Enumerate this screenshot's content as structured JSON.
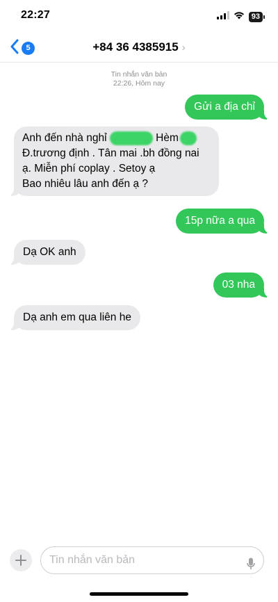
{
  "status_bar": {
    "time": "22:27",
    "battery": "93"
  },
  "nav": {
    "back_count": "5",
    "title": "+84 36 4385915"
  },
  "meta": {
    "line1": "Tin nhắn văn bản",
    "line2": "22:26, Hôm nay"
  },
  "messages": [
    {
      "direction": "outgoing",
      "text": "Gửi a địa chỉ"
    },
    {
      "direction": "incoming",
      "lines": [
        "Anh đến nhà nghỉ",
        "Hèm",
        "Đ.trương định . Tân mai .bh  đồng nai",
        "ạ. Miễn phí coplay . Setoy ạ",
        "Bao nhiêu lâu anh đến ạ ?"
      ]
    },
    {
      "direction": "outgoing",
      "text": "15p nữa a qua"
    },
    {
      "direction": "incoming",
      "text": "Dạ OK anh"
    },
    {
      "direction": "outgoing",
      "text": "03 nha"
    },
    {
      "direction": "incoming",
      "text": "Dạ anh em qua liên he"
    }
  ],
  "composer": {
    "placeholder": "Tin nhắn văn bản"
  },
  "colors": {
    "outgoing": "#33c759",
    "incoming": "#e9e9eb",
    "accent": "#1a7cf5"
  }
}
